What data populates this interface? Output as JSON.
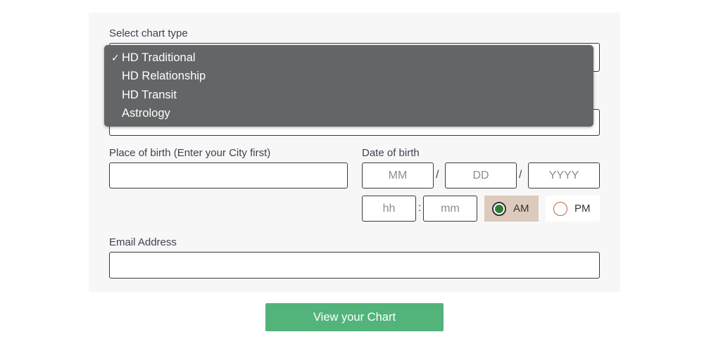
{
  "form": {
    "chart_type_label": "Select chart type",
    "chart_type_options": [
      {
        "label": "HD Traditional",
        "selected": true
      },
      {
        "label": "HD Relationship",
        "selected": false
      },
      {
        "label": "HD Transit",
        "selected": false
      },
      {
        "label": "Astrology",
        "selected": false
      }
    ],
    "selected_check": "✓",
    "place_label": "Place of birth (Enter your City first)",
    "place_value": "",
    "date_label": "Date of birth",
    "date_month_placeholder": "MM",
    "date_day_placeholder": "DD",
    "date_year_placeholder": "YYYY",
    "date_separator": "/",
    "time_hour_placeholder": "hh",
    "time_minute_placeholder": "mm",
    "time_separator": ":",
    "am_label": "AM",
    "pm_label": "PM",
    "am_selected": true,
    "email_label": "Email Address",
    "email_value": "",
    "submit_label": "View your Chart"
  },
  "colors": {
    "card_bg": "#f7f7f7",
    "submit_bg": "#52b47b",
    "am_selected_bg": "#dccabc",
    "radio_fill": "#2f7d32",
    "dropdown_bg": "#646566"
  }
}
